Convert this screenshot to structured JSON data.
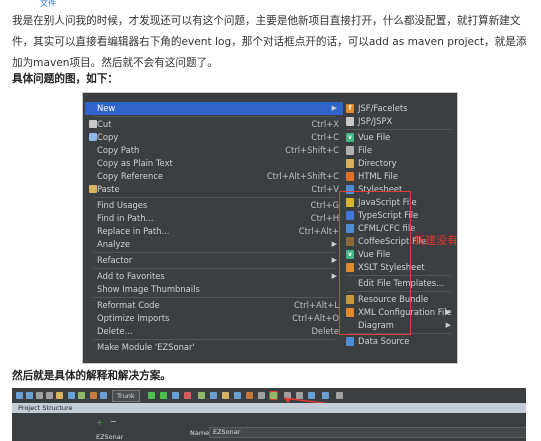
{
  "top_link": "文件",
  "paragraph": "我是在别人问我的时候，才发现还可以有这个问题，主要是他新项目直接打开，什么都没配置，就打算新建文件，其实可以直接看编辑器右下角的event log，那个对话框点开的话，可以add as maven project，就是添加为maven项目。然后就不会有这问题了。",
  "heading1": "具体问题的图，如下：",
  "heading2": "然后就是具体的解释和解决方案。",
  "annotation": "新建没有没有Java class",
  "context_menu": [
    {
      "label": "New",
      "shortcut": "",
      "submenu": true,
      "highlight": true,
      "icon_color": ""
    },
    {
      "label": "Cut",
      "shortcut": "Ctrl+X",
      "icon_color": "#c9c9c9"
    },
    {
      "label": "Copy",
      "shortcut": "Ctrl+C",
      "icon_color": "#8fb6e8"
    },
    {
      "label": "Copy Path",
      "shortcut": "Ctrl+Shift+C"
    },
    {
      "label": "Copy as Plain Text",
      "shortcut": ""
    },
    {
      "label": "Copy Reference",
      "shortcut": "Ctrl+Alt+Shift+C"
    },
    {
      "label": "Paste",
      "shortcut": "Ctrl+V",
      "icon_color": "#d6b25c"
    },
    {
      "label": "Find Usages",
      "shortcut": "Ctrl+G"
    },
    {
      "label": "Find in Path...",
      "shortcut": "Ctrl+H"
    },
    {
      "label": "Replace in Path...",
      "shortcut": "Ctrl+Alt+"
    },
    {
      "label": "Analyze",
      "shortcut": "",
      "submenu": true
    },
    {
      "label": "Refactor",
      "shortcut": "",
      "submenu": true
    },
    {
      "label": "Add to Favorites",
      "shortcut": "",
      "submenu": true
    },
    {
      "label": "Show Image Thumbnails",
      "shortcut": ""
    },
    {
      "label": "Reformat Code",
      "shortcut": "Ctrl+Alt+L"
    },
    {
      "label": "Optimize Imports",
      "shortcut": "Ctrl+Alt+O"
    },
    {
      "label": "Delete...",
      "shortcut": "Delete"
    },
    {
      "label": "Make Module 'EZSonar'",
      "shortcut": ""
    }
  ],
  "new_submenu": [
    {
      "label": "JSF/Facelets",
      "icon_color": "#e08c2e",
      "glyph": "f"
    },
    {
      "label": "JSP/JSPX",
      "icon_color": "#c9c9c9",
      "glyph": ""
    },
    {
      "label": "Vue File",
      "icon_color": "#41b883",
      "glyph": "v"
    },
    {
      "label": "File",
      "icon_color": "#b0b0b0",
      "glyph": ""
    },
    {
      "label": "Directory",
      "icon_color": "#d6b25c",
      "glyph": ""
    },
    {
      "label": "HTML File",
      "icon_color": "#e06c2e",
      "glyph": ""
    },
    {
      "label": "Stylesheet",
      "icon_color": "#4c8dd6",
      "glyph": ""
    },
    {
      "label": "JavaScript File",
      "icon_color": "#d6b52e",
      "glyph": ""
    },
    {
      "label": "TypeScript File",
      "icon_color": "#3d7ad6",
      "glyph": ""
    },
    {
      "label": "CFML/CFC file",
      "icon_color": "#4c8dd6",
      "glyph": ""
    },
    {
      "label": "CoffeeScript File",
      "icon_color": "#8a6a3a",
      "glyph": ""
    },
    {
      "label": "Vue File",
      "icon_color": "#41b883",
      "glyph": "v"
    },
    {
      "label": "XSLT Stylesheet",
      "icon_color": "#e08c2e",
      "glyph": ""
    },
    {
      "label": "Edit File Templates...",
      "icon_color": "",
      "glyph": ""
    },
    {
      "label": "Resource Bundle",
      "icon_color": "#c79a3a",
      "glyph": ""
    },
    {
      "label": "XML Configuration File",
      "icon_color": "#e08c2e",
      "glyph": "",
      "submenu": true
    },
    {
      "label": "Diagram",
      "icon_color": "",
      "glyph": "",
      "submenu": true
    },
    {
      "label": "Data Source",
      "icon_color": "#4c8dd6",
      "glyph": ""
    }
  ],
  "ide": {
    "trunk_label": "Trunk",
    "panel_title": "Project Structure",
    "project_name": "EZSonar",
    "name_label": "Name:",
    "name_value": "EZSonar"
  }
}
